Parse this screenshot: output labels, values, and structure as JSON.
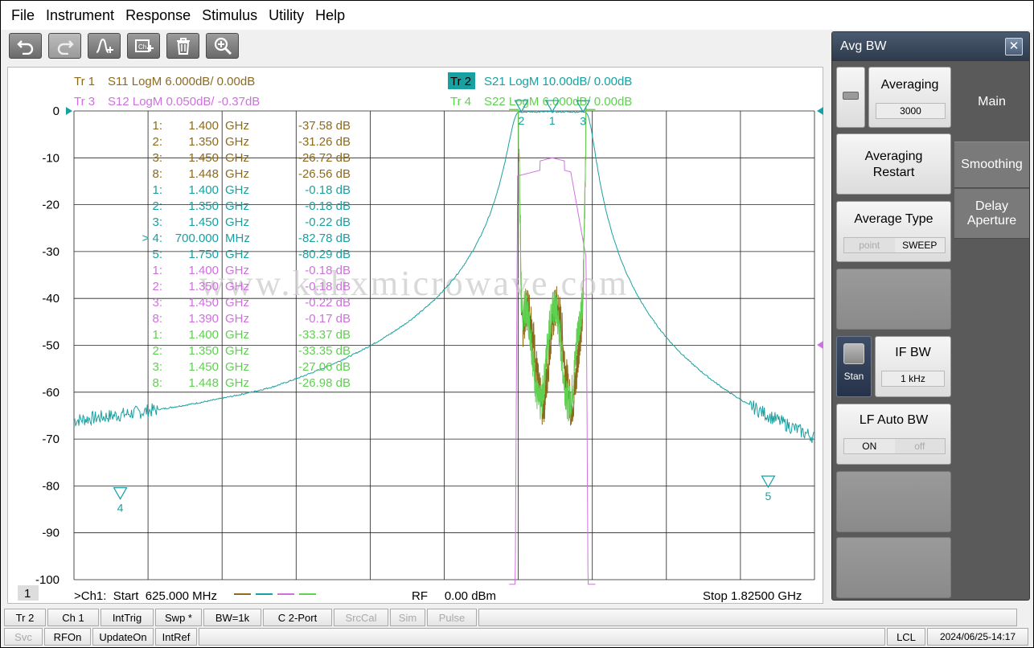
{
  "menu": [
    "File",
    "Instrument",
    "Response",
    "Stimulus",
    "Utility",
    "Help"
  ],
  "toolbar": {
    "icons": [
      "undo-icon",
      "redo-icon",
      "add-trace-icon",
      "add-channel-icon",
      "delete-icon",
      "zoom-icon"
    ]
  },
  "traces": {
    "tr1": {
      "label": "Tr 1",
      "text": "S11 LogM 6.000dB/  0.00dB",
      "color": "#8c6b1e"
    },
    "tr2": {
      "label": "Tr 2",
      "text": "S21 LogM 10.00dB/  0.00dB",
      "color": "#1aa0a0"
    },
    "tr3": {
      "label": "Tr 3",
      "text": "S12 LogM 0.050dB/ -0.37dB",
      "color": "#d070e0"
    },
    "tr4": {
      "label": "Tr 4",
      "text": "S22 LogM 6.000dB/  0.00dB",
      "color": "#60d050"
    }
  },
  "y_axis": [
    "0",
    "-10",
    "-20",
    "-30",
    "-40",
    "-50",
    "-60",
    "-70",
    "-80",
    "-90",
    "-100"
  ],
  "marker_table": [
    {
      "id": "1:",
      "freq": "1.400",
      "unit": "GHz",
      "value": "-37.58 dB",
      "color": "#8c6b1e"
    },
    {
      "id": "2:",
      "freq": "1.350",
      "unit": "GHz",
      "value": "-31.26 dB",
      "color": "#8c6b1e"
    },
    {
      "id": "3:",
      "freq": "1.450",
      "unit": "GHz",
      "value": "-26.72 dB",
      "color": "#8c6b1e"
    },
    {
      "id": "8:",
      "freq": "1.448",
      "unit": "GHz",
      "value": "-26.56 dB",
      "color": "#8c6b1e"
    },
    {
      "id": "1:",
      "freq": "1.400",
      "unit": "GHz",
      "value": "-0.18 dB",
      "color": "#1aa0a0"
    },
    {
      "id": "2:",
      "freq": "1.350",
      "unit": "GHz",
      "value": "-0.18 dB",
      "color": "#1aa0a0"
    },
    {
      "id": "3:",
      "freq": "1.450",
      "unit": "GHz",
      "value": "-0.22 dB",
      "color": "#1aa0a0"
    },
    {
      "id": "> 4:",
      "freq": "700.000",
      "unit": "MHz",
      "value": "-82.78 dB",
      "color": "#1aa0a0"
    },
    {
      "id": "5:",
      "freq": "1.750",
      "unit": "GHz",
      "value": "-80.29 dB",
      "color": "#1aa0a0"
    },
    {
      "id": "1:",
      "freq": "1.400",
      "unit": "GHz",
      "value": "-0.18 dB",
      "color": "#d070e0"
    },
    {
      "id": "2:",
      "freq": "1.350",
      "unit": "GHz",
      "value": "-0.18 dB",
      "color": "#d070e0"
    },
    {
      "id": "3:",
      "freq": "1.450",
      "unit": "GHz",
      "value": "-0.22 dB",
      "color": "#d070e0"
    },
    {
      "id": "8:",
      "freq": "1.390",
      "unit": "GHz",
      "value": "-0.17 dB",
      "color": "#d070e0"
    },
    {
      "id": "1:",
      "freq": "1.400",
      "unit": "GHz",
      "value": "-33.37 dB",
      "color": "#60d050"
    },
    {
      "id": "2:",
      "freq": "1.350",
      "unit": "GHz",
      "value": "-33.35 dB",
      "color": "#60d050"
    },
    {
      "id": "3:",
      "freq": "1.450",
      "unit": "GHz",
      "value": "-27.06 dB",
      "color": "#60d050"
    },
    {
      "id": "8:",
      "freq": "1.448",
      "unit": "GHz",
      "value": "-26.98 dB",
      "color": "#60d050"
    }
  ],
  "watermark": "www.kahxmicrowave.com",
  "footer": {
    "channel_badge": "1",
    "start": ">Ch1:  Start  625.000 MHz",
    "rf": "RF     0.00 dBm",
    "stop": "Stop  1.82500 GHz"
  },
  "panel": {
    "title": "Avg BW",
    "close": "✕",
    "tabs": [
      "Main",
      "Smoothing",
      "Delay\nAperture"
    ],
    "averaging": {
      "label": "Averaging",
      "value": "3000"
    },
    "restart": "Averaging\nRestart",
    "avg_type": {
      "label": "Average Type",
      "opt1": "point",
      "opt2": "SWEEP"
    },
    "stan": "Stan",
    "ifbw": {
      "label": "IF BW",
      "value": "1 kHz"
    },
    "lf": {
      "label": "LF Auto BW",
      "on": "ON",
      "off": "off"
    }
  },
  "status1": [
    "Tr 2",
    "Ch 1",
    "IntTrig",
    "Swp *",
    "BW=1k",
    "C  2-Port",
    "SrcCal",
    "Sim",
    "Pulse"
  ],
  "status2": [
    "Svc",
    "RFOn",
    "UpdateOn",
    "IntRef",
    "LCL",
    "2024/06/25-14:17"
  ],
  "chart_data": {
    "type": "line",
    "x_range_mhz": [
      625,
      1825
    ],
    "ylim": [
      -100,
      0
    ],
    "grid": true,
    "series": [
      {
        "name": "S11",
        "color": "#8c6b1e"
      },
      {
        "name": "S21",
        "color": "#1aa0a0"
      },
      {
        "name": "S12",
        "color": "#d070e0"
      },
      {
        "name": "S22",
        "color": "#60d050"
      }
    ],
    "markers": {
      "s21": [
        {
          "label": "1",
          "x": 1400,
          "y": -0.18
        },
        {
          "label": "2",
          "x": 1350,
          "y": -0.18
        },
        {
          "label": "3",
          "x": 1450,
          "y": -0.22
        },
        {
          "label": "4",
          "x": 700,
          "y": -82.78
        },
        {
          "label": "5",
          "x": 1750,
          "y": -80.29
        }
      ]
    }
  }
}
